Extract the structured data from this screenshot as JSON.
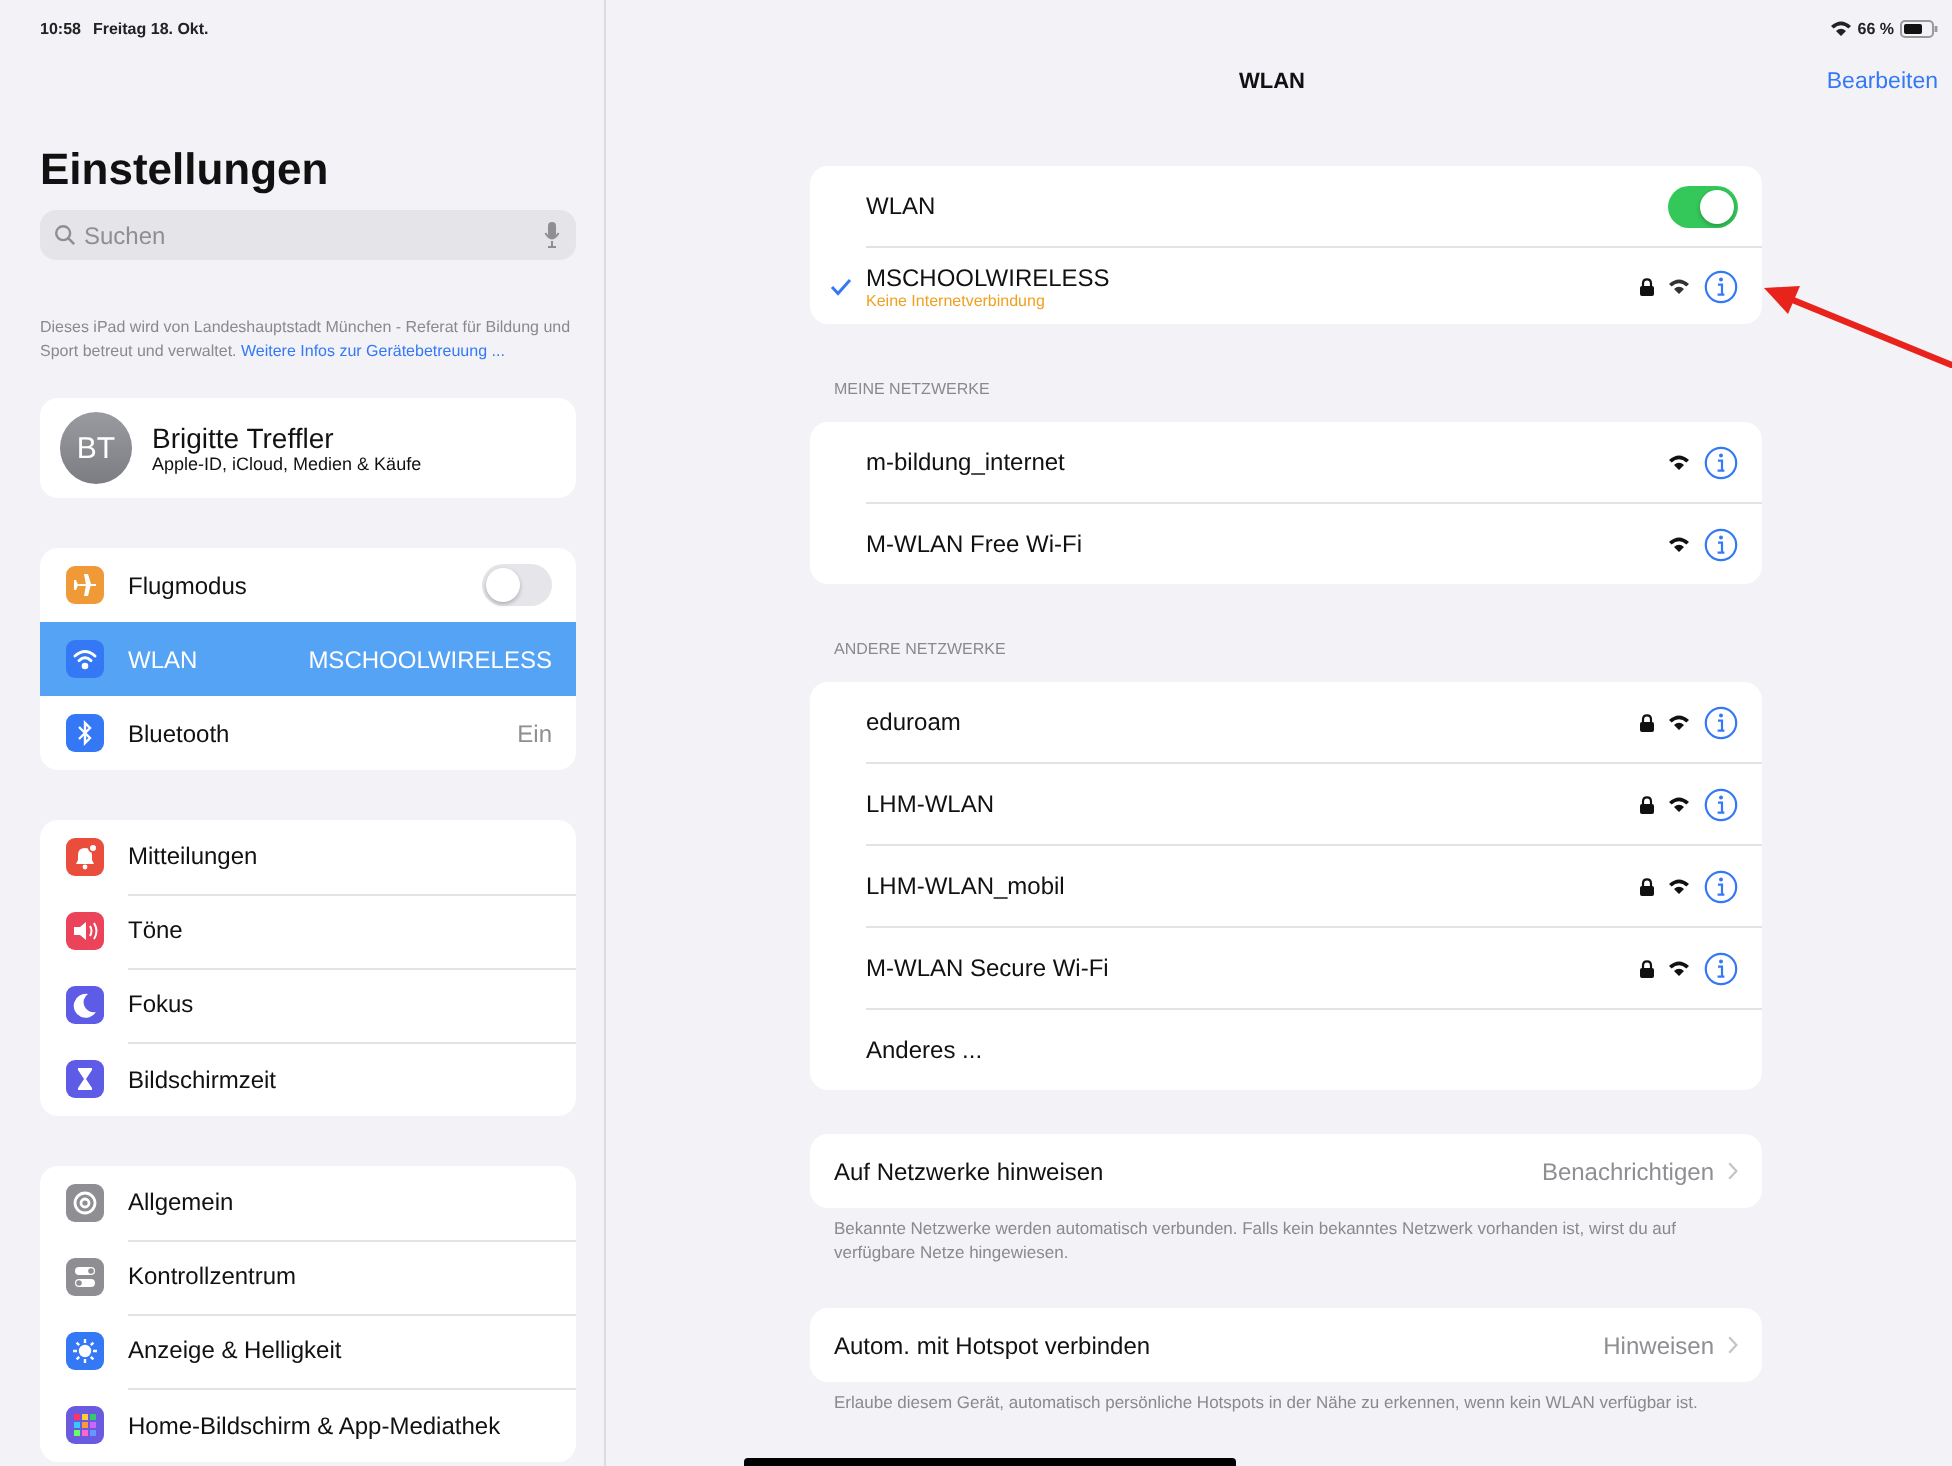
{
  "status_bar": {
    "time": "10:58",
    "date": "Freitag 18. Okt.",
    "battery": "66 %"
  },
  "sidebar": {
    "title": "Einstellungen",
    "search": {
      "placeholder": "Suchen"
    },
    "note": {
      "text": "Dieses iPad wird von Landeshauptstadt München - Referat für Bildung und Sport betreut und verwaltet.",
      "link": "Weitere Infos zur Gerätebetreuung ..."
    },
    "profile": {
      "initials": "BT",
      "name": "Brigitte Treffler",
      "subtitle": "Apple-ID, iCloud, Medien & Käufe"
    },
    "groups": [
      [
        {
          "label": "Flugmodus",
          "kind": "toggle",
          "on": false,
          "selected": false,
          "color": "#f09a37"
        },
        {
          "label": "WLAN",
          "kind": "value",
          "value": "MSCHOOLWIRELESS",
          "selected": true,
          "color": "#3478f6"
        },
        {
          "label": "Bluetooth",
          "kind": "value",
          "value": "Ein",
          "selected": false,
          "color": "#3478f6"
        }
      ],
      [
        {
          "label": "Mitteilungen",
          "kind": "link",
          "selected": false,
          "color": "#eb4d3d"
        },
        {
          "label": "Töne",
          "kind": "link",
          "selected": false,
          "color": "#eb445a"
        },
        {
          "label": "Fokus",
          "kind": "link",
          "selected": false,
          "color": "#5e5ce6"
        },
        {
          "label": "Bildschirmzeit",
          "kind": "link",
          "selected": false,
          "color": "#5e5ce6"
        }
      ],
      [
        {
          "label": "Allgemein",
          "kind": "link",
          "selected": false,
          "color": "#8e8e93"
        },
        {
          "label": "Kontrollzentrum",
          "kind": "link",
          "selected": false,
          "color": "#8e8e93"
        },
        {
          "label": "Anzeige & Helligkeit",
          "kind": "link",
          "selected": false,
          "color": "#3478f6"
        },
        {
          "label": "Home-Bildschirm & App-Mediathek",
          "kind": "link",
          "selected": false,
          "color": "#6a5ae0"
        }
      ]
    ]
  },
  "detail": {
    "title": "WLAN",
    "edit": "Bearbeiten",
    "wlan": {
      "label": "WLAN",
      "on": true
    },
    "current": {
      "name": "MSCHOOLWIRELESS",
      "status": "Keine Internetverbindung",
      "locked": true,
      "connected": true
    },
    "sections": [
      {
        "header": "MEINE NETZWERKE",
        "networks": [
          {
            "name": "m-bildung_internet",
            "locked": false
          },
          {
            "name": "M-WLAN Free Wi-Fi",
            "locked": false
          }
        ]
      },
      {
        "header": "ANDERE NETZWERKE",
        "networks": [
          {
            "name": "eduroam",
            "locked": true
          },
          {
            "name": "LHM-WLAN",
            "locked": true
          },
          {
            "name": "LHM-WLAN_mobil",
            "locked": true
          },
          {
            "name": "M-WLAN Secure Wi-Fi",
            "locked": true
          }
        ],
        "other": "Anderes ..."
      }
    ],
    "options": [
      {
        "label": "Auf Netzwerke hinweisen",
        "value": "Benachrichtigen",
        "footer": "Bekannte Netzwerke werden automatisch verbunden. Falls kein bekanntes Netzwerk vorhanden ist, wirst du auf verfügbare Netze hingewiesen."
      },
      {
        "label": "Autom. mit Hotspot verbinden",
        "value": "Hinweisen",
        "footer": "Erlaube diesem Gerät, automatisch persönliche Hotspots in der Nähe zu erkennen, wenn kein WLAN verfügbar ist."
      }
    ]
  }
}
